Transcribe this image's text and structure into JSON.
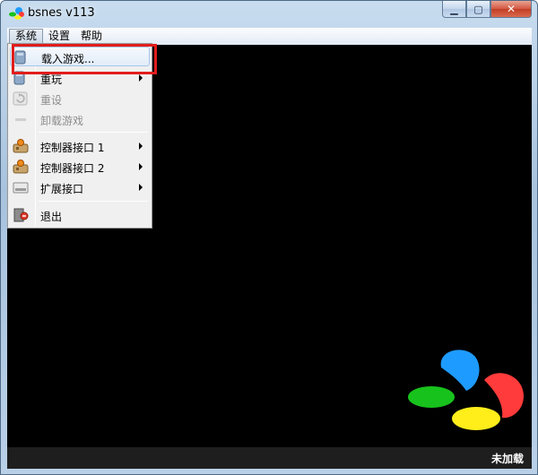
{
  "window": {
    "title": "bsnes v113"
  },
  "window_controls": {
    "minimize": "▁",
    "maximize": "▢",
    "close": "✕"
  },
  "menubar": [
    {
      "label": "系统",
      "open": true
    },
    {
      "label": "设置"
    },
    {
      "label": "帮助"
    }
  ],
  "system_menu": {
    "load_game": "载入游戏...",
    "reset_play": "重玩",
    "reset": "重设",
    "unload_game": "卸载游戏",
    "controller_port_1": "控制器接口 1",
    "controller_port_2": "控制器接口 2",
    "expansion_port": "扩展接口",
    "quit": "退出"
  },
  "status": {
    "text": "未加载"
  },
  "logo_colors": {
    "blue": "#1e9bff",
    "red": "#ff3b3b",
    "green": "#18c21c",
    "yellow": "#ffee1a"
  },
  "highlight_color": "#e21c1c"
}
